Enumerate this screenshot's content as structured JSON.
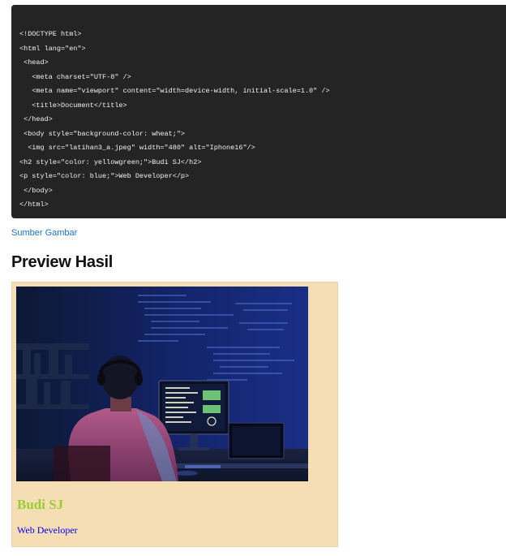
{
  "code": {
    "lines": [
      "<!DOCTYPE html>",
      "<html lang=\"en\">",
      " <head>",
      "   <meta charset=\"UTF-8\" />",
      "   <meta name=\"viewport\" content=\"width=device-width, initial-scale=1.0\" />",
      "   <title>Document</title>",
      " </head>",
      " <body style=\"background-color: wheat;\">",
      "  <img src=\"latihan3_a.jpeg\" width=\"480\" alt=\"Iphone16\"/>",
      "<h2 style=\"color: yellowgreen;\">Budi SJ</h2>",
      "<p style=\"color: blue;\">Web Developer</p>",
      " </body>",
      "</html>"
    ]
  },
  "source_link": "Sumber Gambar",
  "preview_heading": "Preview Hasil",
  "preview": {
    "image_alt": "Iphone16",
    "name": "Budi SJ",
    "role": "Web Developer",
    "background": "#f5deb3",
    "name_color": "#9acd32",
    "role_color": "#0000ff"
  }
}
